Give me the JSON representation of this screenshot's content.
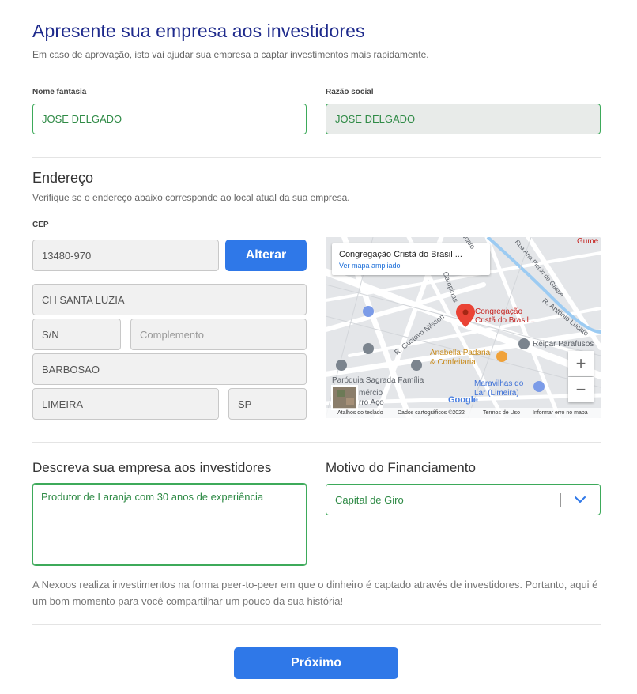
{
  "header": {
    "title": "Apresente sua empresa aos investidores",
    "subtitle": "Em caso de aprovação, isto vai ajudar sua empresa a captar investimentos mais rapidamente."
  },
  "company": {
    "nome_fantasia_label": "Nome fantasia",
    "nome_fantasia_value": "JOSE DELGADO",
    "razao_social_label": "Razão social",
    "razao_social_value": "JOSE DELGADO"
  },
  "address": {
    "title": "Endereço",
    "subtitle": "Verifique se o endereço abaixo corresponde ao local atual da sua empresa.",
    "cep_label": "CEP",
    "cep_value": "13480-970",
    "alterar_label": "Alterar",
    "street": "CH SANTA LUZIA",
    "number": "S/N",
    "complement_placeholder": "Complemento",
    "neighborhood": "BARBOSAO",
    "city": "LIMEIRA",
    "state": "SP"
  },
  "map": {
    "card_title": "Congregação Cristã do Brasil ...",
    "card_link": "Ver mapa ampliado",
    "place_label_1": "Congregação",
    "place_label_2": "Cristã do Brasil...",
    "street_1": "R. Gustavo Nilsson",
    "street_2": "Rua Ana Piccin de Gaspe",
    "street_3": "R. Antônio Lucato",
    "street_4": "Lucato",
    "street_5": "Campinas",
    "poi_1": "Anabella Padaria",
    "poi_1b": "& Confeitaria",
    "poi_2": "Reipar Parafusos",
    "poi_3": "Paróquia Sagrada Família",
    "poi_4": "Maravilhas do",
    "poi_4b": "Lar (Limeira)",
    "poi_5": "Gume",
    "poi_6": "mércio",
    "poi_7": "rro Aço",
    "brand": "Google",
    "footer_1": "Atalhos do teclado",
    "footer_2": "Dados cartográficos ©2022",
    "footer_3": "Termos de Uso",
    "footer_4": "Informar erro no mapa",
    "zoom_in": "+",
    "zoom_out": "−"
  },
  "description": {
    "title": "Descreva sua empresa aos investidores",
    "value": "Produtor de Laranja com 30 anos de experiência",
    "note": "A Nexoos realiza investimentos na forma peer-to-peer em que o dinheiro é captado através de investidores. Portanto, aqui é um bom momento para você compartilhar um pouco da sua história!"
  },
  "financing": {
    "title": "Motivo do Financiamento",
    "selected": "Capital de Giro"
  },
  "actions": {
    "next_label": "Próximo"
  },
  "colors": {
    "accent": "#2f78e8",
    "title": "#1e2a8c",
    "valid_border": "#3daa5a",
    "map_pin": "#ea4335"
  }
}
